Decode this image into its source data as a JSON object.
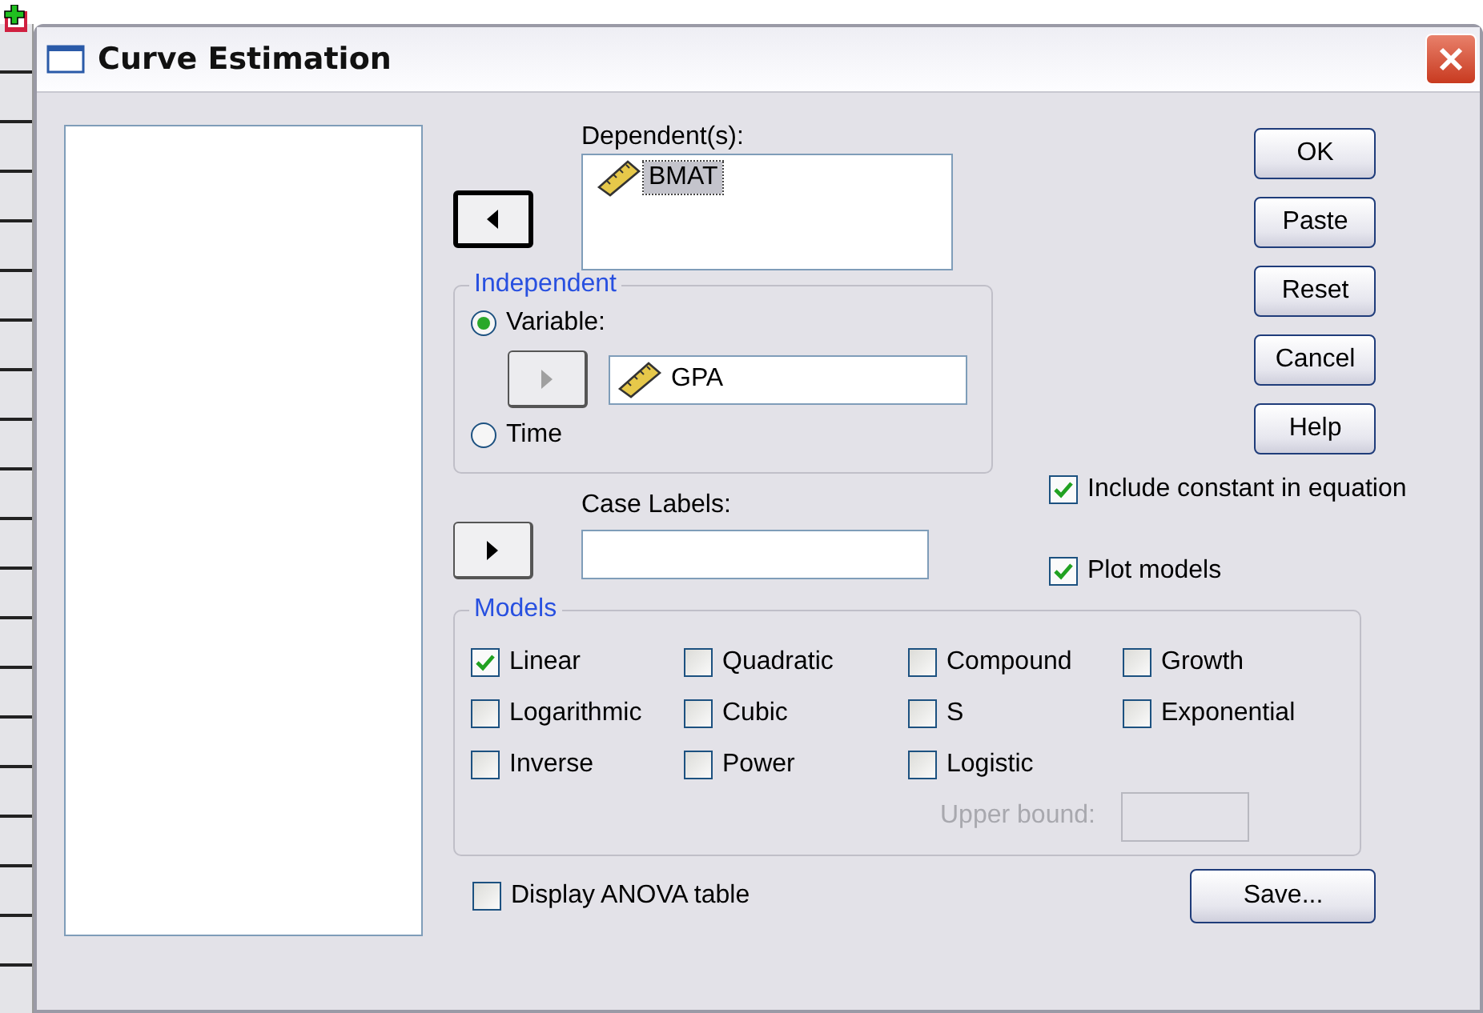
{
  "window": {
    "title": "Curve Estimation"
  },
  "dependents": {
    "label": "Dependent(s):",
    "items": [
      {
        "name": "BMAT",
        "selected": true
      }
    ]
  },
  "arrows": [
    {
      "kind": "left",
      "focused": true,
      "disabled": false
    },
    {
      "kind": "right",
      "focused": false,
      "disabled": true
    },
    {
      "kind": "right",
      "focused": false,
      "disabled": false
    }
  ],
  "independent": {
    "legend": "Independent",
    "options": [
      {
        "label": "Variable:",
        "selected": true
      },
      {
        "label": "Time",
        "selected": false
      }
    ],
    "variable": "GPA"
  },
  "case_labels": {
    "label": "Case Labels:"
  },
  "buttons": [
    "OK",
    "Paste",
    "Reset",
    "Cancel",
    "Help"
  ],
  "options": [
    {
      "label": "Include constant in equation",
      "checked": true
    },
    {
      "label": "Plot models",
      "checked": true
    }
  ],
  "models": {
    "legend": "Models",
    "items": [
      {
        "label": "Linear",
        "checked": true
      },
      {
        "label": "Quadratic",
        "checked": false
      },
      {
        "label": "Compound",
        "checked": false
      },
      {
        "label": "Growth",
        "checked": false
      },
      {
        "label": "Logarithmic",
        "checked": false
      },
      {
        "label": "Cubic",
        "checked": false
      },
      {
        "label": "S",
        "checked": false
      },
      {
        "label": "Exponential",
        "checked": false
      },
      {
        "label": "Inverse",
        "checked": false
      },
      {
        "label": "Power",
        "checked": false
      },
      {
        "label": "Logistic",
        "checked": false
      }
    ],
    "upper_bound": {
      "label": "Upper bound:",
      "disabled": true
    }
  },
  "anova": {
    "label": "Display ANOVA table",
    "checked": false
  },
  "save_button": "Save..."
}
